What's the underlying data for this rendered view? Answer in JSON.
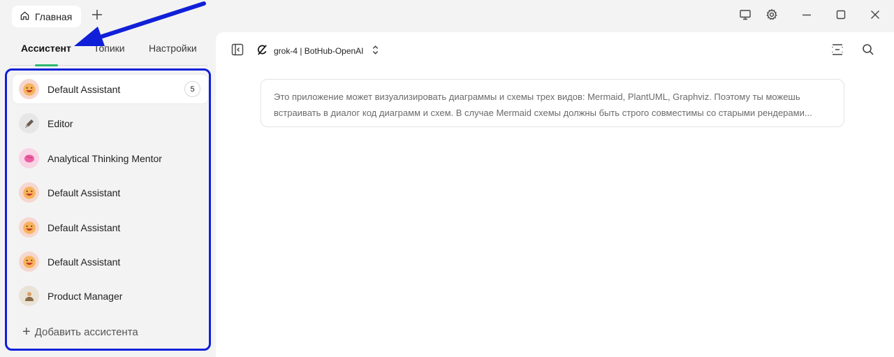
{
  "window": {
    "tab_label": "Главная",
    "tab_icon": "home-icon"
  },
  "sidebar": {
    "tabs": [
      {
        "label": "Ассистент",
        "active": true
      },
      {
        "label": "Топики",
        "active": false
      },
      {
        "label": "Настройки",
        "active": false
      }
    ],
    "items": [
      {
        "label": "Default Assistant",
        "avatar": "grinning-face-icon",
        "badge": "5",
        "selected": true
      },
      {
        "label": "Editor",
        "avatar": "pen-icon"
      },
      {
        "label": "Analytical Thinking Mentor",
        "avatar": "brain-icon"
      },
      {
        "label": "Default Assistant",
        "avatar": "grinning-face-icon"
      },
      {
        "label": "Default Assistant",
        "avatar": "grinning-face-icon"
      },
      {
        "label": "Default Assistant",
        "avatar": "grinning-face-icon"
      },
      {
        "label": "Product Manager",
        "avatar": "businessperson-icon"
      }
    ],
    "add_label": "Добавить ассистента"
  },
  "main": {
    "model_label": "grok-4 | BotHub-OpenAI",
    "prompt_lines": [
      "Это приложение может визуализировать диаграммы и схемы трех видов: Mermaid, PlantUML, Graphviz. Поэтому ты можешь",
      "встраивать в диалог код диаграмм и схем. В случае Mermaid схемы должны быть строго совместимы со старыми рендерами..."
    ]
  },
  "colors": {
    "accent_underline": "#2eb872",
    "highlight_border": "#1020d8",
    "annotation_arrow": "#1020d8"
  }
}
